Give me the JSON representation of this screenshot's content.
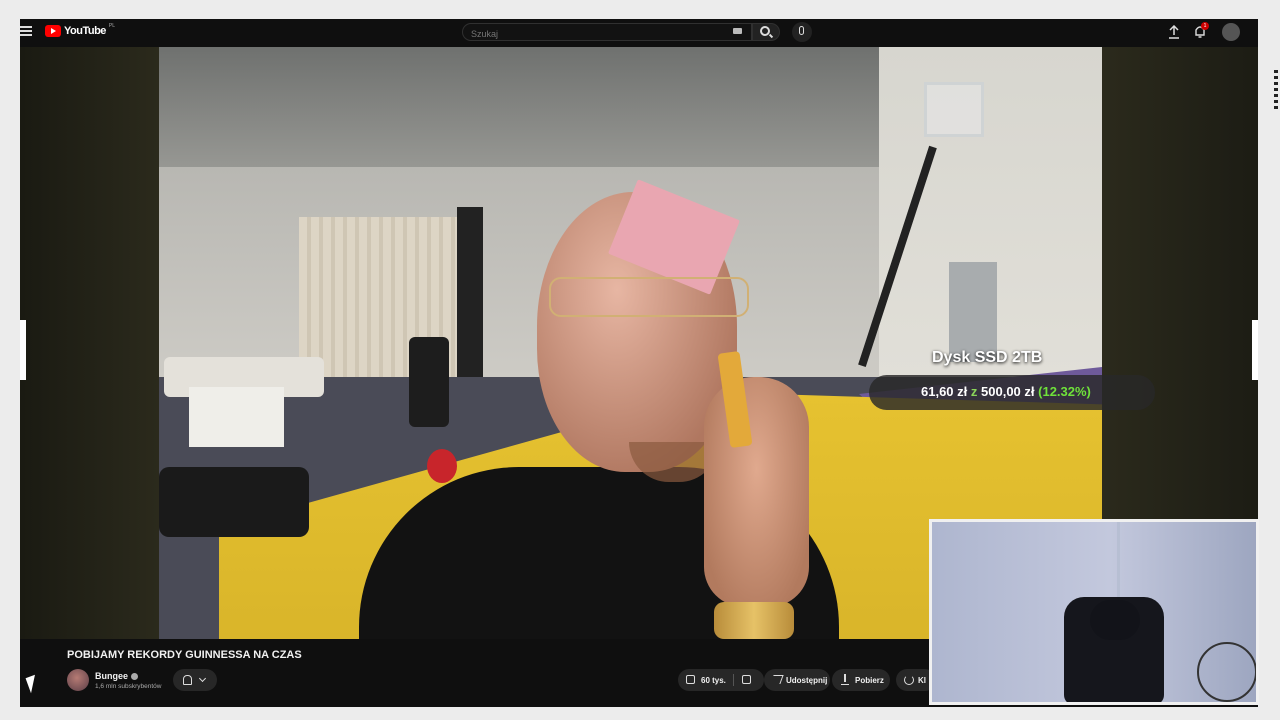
{
  "topbar": {
    "logo_text": "YouTube",
    "logo_country": "PL",
    "search_placeholder": "Szukaj",
    "notification_count": "1"
  },
  "video": {
    "title": "POBIJAMY REKORDY GUINNESSA NA CZAS",
    "overlay": {
      "product": "Dysk SSD 2TB",
      "raised": "61,60 zł",
      "separator": "z",
      "goal": "500,00 zł",
      "percent": "(12.32%)"
    }
  },
  "channel": {
    "name": "Bungee",
    "subscribers": "1,6 mln subskrybentów"
  },
  "actions": {
    "likes": "60 tys.",
    "share_label": "Udostępnij",
    "download_label": "Pobierz",
    "clip_label": "Kl"
  },
  "colors": {
    "brand_red": "#ff0000",
    "overlay_green": "#6fe23a",
    "background": "#0f0f0f"
  }
}
